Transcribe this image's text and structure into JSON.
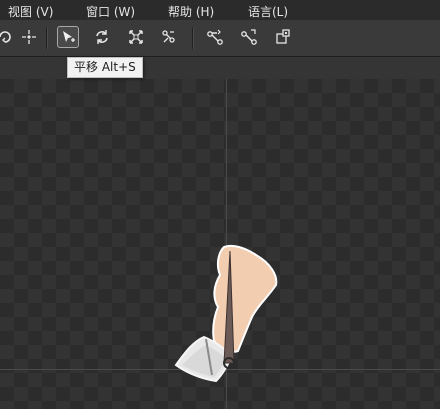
{
  "menu": {
    "items": [
      {
        "label": "视图 (V)"
      },
      {
        "label": "窗口 (W)"
      },
      {
        "label": "帮助 (H)"
      },
      {
        "label": "语言(L)"
      }
    ]
  },
  "toolbar": {
    "tools": [
      {
        "icon": "rotate-view-icon"
      },
      {
        "icon": "move-pivot-icon"
      },
      {
        "icon": "translate-tool-icon",
        "active": true
      },
      {
        "icon": "rotate-tool-icon"
      },
      {
        "icon": "scale-tool-icon"
      },
      {
        "icon": "skew-tool-icon"
      },
      {
        "icon": "create-bone-icon"
      },
      {
        "icon": "edit-bone-icon"
      },
      {
        "icon": "bind-mesh-icon"
      }
    ],
    "tooltip": "平移 Alt+S"
  },
  "colors": {
    "accent": "#e8e8e8",
    "skin": "#f2cdb0",
    "bone": "#6b5a55",
    "canvas_dark": "#2c2c2c",
    "canvas_light": "#333333"
  }
}
